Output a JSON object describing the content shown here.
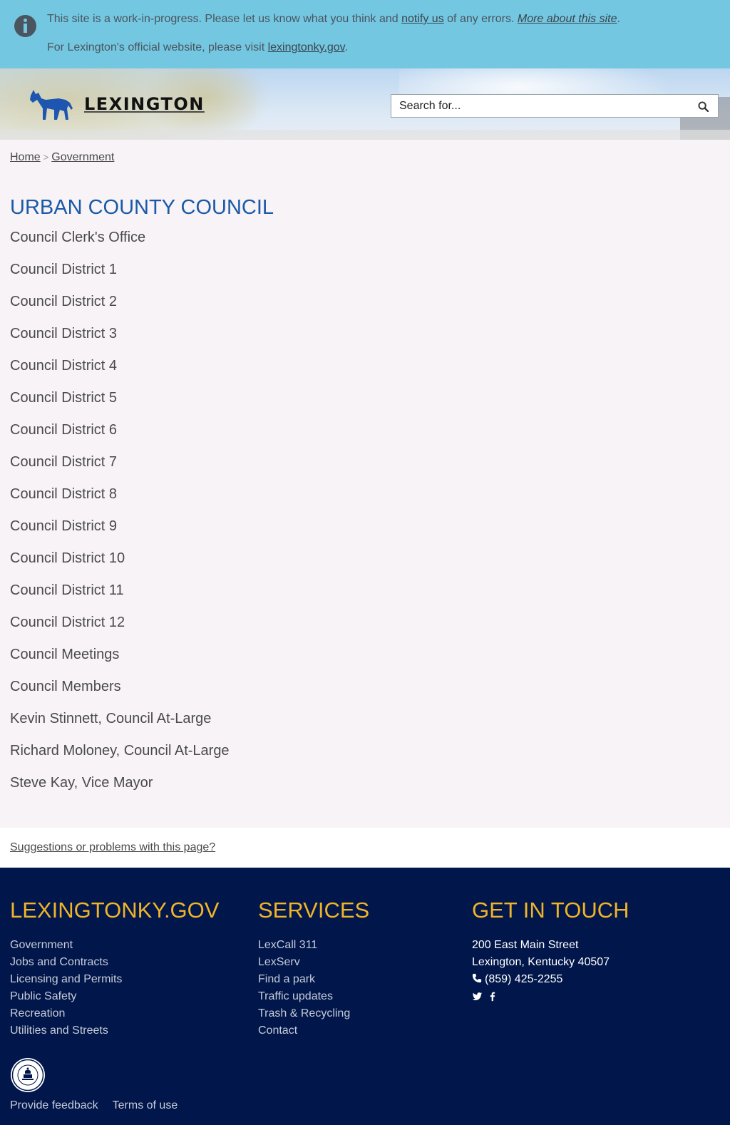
{
  "alert": {
    "line1_prefix": "This site is a work-in-progress. Please let us know what you think and ",
    "notify_link": "notify us",
    "line1_mid": " of any errors. ",
    "more_link": "More about this site",
    "line1_suffix": ".",
    "line2_prefix": "For Lexington's official website, please visit ",
    "official_link": "lexingtonky.gov",
    "line2_suffix": "."
  },
  "header": {
    "brand": "LEXINGTON",
    "logo_icon": "horse-icon",
    "search_placeholder": "Search for...",
    "search_icon": "search-icon"
  },
  "breadcrumb": {
    "items": [
      "Home",
      "Government"
    ],
    "separator": ">"
  },
  "main": {
    "title": "URBAN COUNTY COUNCIL",
    "items": [
      "Council Clerk's Office",
      "Council District 1",
      "Council District 2",
      "Council District 3",
      "Council District 4",
      "Council District 5",
      "Council District 6",
      "Council District 7",
      "Council District 8",
      "Council District 9",
      "Council District 10",
      "Council District 11",
      "Council District 12",
      "Council Meetings",
      "Council Members",
      "Kevin Stinnett, Council At-Large",
      "Richard Moloney, Council At-Large",
      "Steve Kay, Vice Mayor"
    ]
  },
  "suggest": {
    "link": "Suggestions or problems with this page?"
  },
  "footer": {
    "col1": {
      "heading": "LEXINGTONKY.GOV",
      "items": [
        "Government",
        "Jobs and Contracts",
        "Licensing and Permits",
        "Public Safety",
        "Recreation",
        "Utilities and Streets"
      ]
    },
    "col2": {
      "heading": "SERVICES",
      "items": [
        "LexCall 311",
        "LexServ",
        "Find a park",
        "Traffic updates",
        "Trash & Recycling",
        "Contact"
      ]
    },
    "col3": {
      "heading": "GET IN TOUCH",
      "address1": "200 East Main Street",
      "address2": "Lexington, Kentucky 40507",
      "phone": "(859) 425-2255",
      "social_icons": [
        "twitter-icon",
        "facebook-icon"
      ]
    },
    "seal_icon": "city-seal-icon",
    "bottom_links": [
      "Provide feedback",
      "Terms of use"
    ]
  },
  "colors": {
    "alert_bg": "#74c7e0",
    "title": "#1b5aa6",
    "footer_bg": "#01164a",
    "footer_heading": "#f0b429",
    "logo_horse": "#1c56b0"
  }
}
